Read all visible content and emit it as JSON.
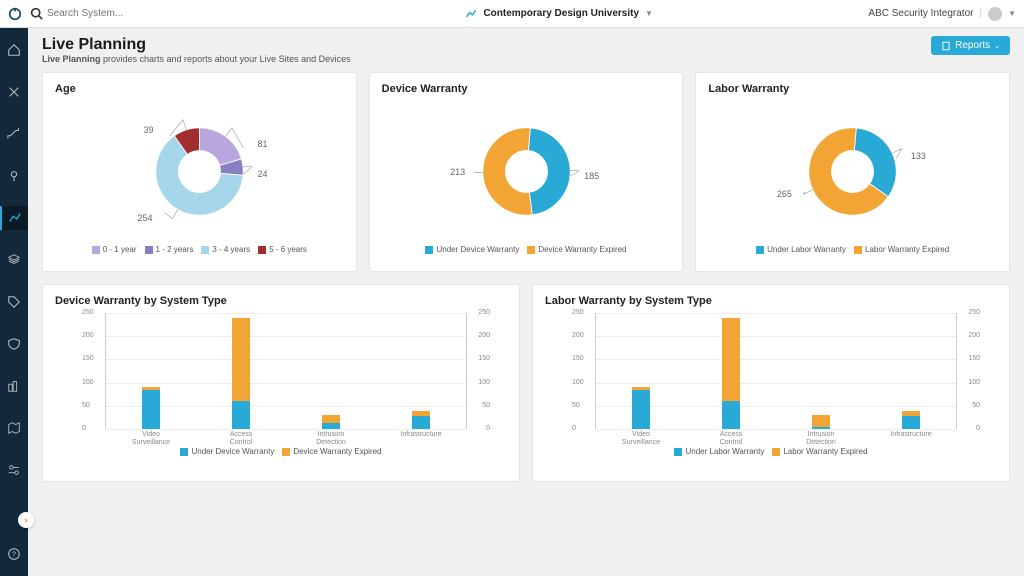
{
  "header": {
    "search_placeholder": "Search System...",
    "org_name": "Contemporary Design University",
    "user_name": "ABC Security Integrator"
  },
  "page": {
    "title": "Live Planning",
    "subtitle_prefix": "Live Planning",
    "subtitle_rest": " provides charts and reports about your Live Sites and Devices",
    "reports_btn": "Reports"
  },
  "colors": {
    "blue_light": "#a6d6ea",
    "blue": "#29a9d6",
    "purple_light": "#b9a6de",
    "purple": "#8a7fc2",
    "orange": "#f2a534",
    "red": "#a02e2e"
  },
  "cards": {
    "age": {
      "title": "Age"
    },
    "device_warranty": {
      "title": "Device Warranty"
    },
    "labor_warranty": {
      "title": "Labor Warranty"
    },
    "device_by_type": {
      "title": "Device Warranty by System Type"
    },
    "labor_by_type": {
      "title": "Labor Warranty by System Type"
    }
  },
  "chart_data": [
    {
      "id": "age",
      "type": "donut",
      "title": "Age",
      "series": [
        {
          "name": "0 - 1 year",
          "value": 81,
          "color": "#b9a6de"
        },
        {
          "name": "1 - 2 years",
          "value": 24,
          "color": "#8a7fc2"
        },
        {
          "name": "3 - 4 years",
          "value": 254,
          "color": "#a6d6ea"
        },
        {
          "name": "5 - 6 years",
          "value": 39,
          "color": "#a02e2e"
        }
      ]
    },
    {
      "id": "device_warranty",
      "type": "donut",
      "title": "Device Warranty",
      "series": [
        {
          "name": "Under Device Warranty",
          "value": 185,
          "color": "#29a9d6"
        },
        {
          "name": "Device Warranty Expired",
          "value": 213,
          "color": "#f2a534"
        }
      ]
    },
    {
      "id": "labor_warranty",
      "type": "donut",
      "title": "Labor Warranty",
      "series": [
        {
          "name": "Under Labor Warranty",
          "value": 133,
          "color": "#29a9d6"
        },
        {
          "name": "Labor Warranty Expired",
          "value": 265,
          "color": "#f2a534"
        }
      ]
    },
    {
      "id": "device_by_type",
      "type": "bar",
      "title": "Device Warranty by System Type",
      "ylim": [
        0,
        250
      ],
      "yticks": [
        0,
        50,
        100,
        150,
        200,
        250
      ],
      "categories": [
        "Video Surveillance",
        "Access Control",
        "Intrusion Detection",
        "Infrastructure"
      ],
      "series": [
        {
          "name": "Under Device Warranty",
          "color": "#29a9d6",
          "values": [
            85,
            60,
            12,
            28
          ]
        },
        {
          "name": "Device Warranty Expired",
          "color": "#f2a534",
          "values": [
            5,
            180,
            18,
            10
          ]
        }
      ]
    },
    {
      "id": "labor_by_type",
      "type": "bar",
      "title": "Labor Warranty by System Type",
      "ylim": [
        0,
        250
      ],
      "yticks": [
        0,
        50,
        100,
        150,
        200,
        250
      ],
      "categories": [
        "Video Surveillance",
        "Access Control",
        "Intrusion Detection",
        "Infrastructure"
      ],
      "series": [
        {
          "name": "Under Labor Warranty",
          "color": "#29a9d6",
          "values": [
            85,
            60,
            5,
            28
          ]
        },
        {
          "name": "Labor Warranty Expired",
          "color": "#f2a534",
          "values": [
            5,
            180,
            25,
            10
          ]
        }
      ]
    }
  ]
}
